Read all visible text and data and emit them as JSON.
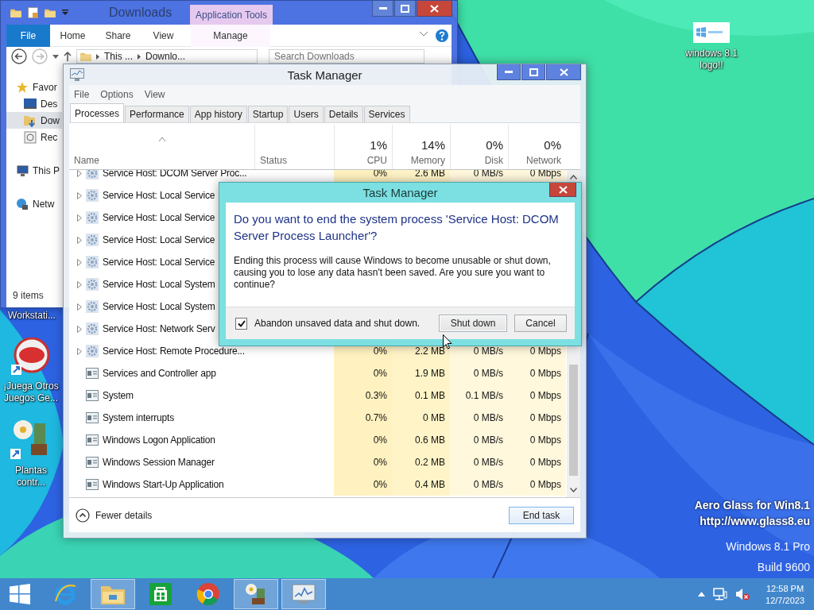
{
  "desktop": {
    "icons": [
      {
        "label": "Workstati...",
        "kind": "hidden"
      },
      {
        "label": "¡Juega Otros Juegos Ge...",
        "kind": "popcap"
      },
      {
        "label": "Plantas contr...",
        "kind": "plants"
      },
      {
        "label": "windows 8.1 logo!!"
      }
    ],
    "overlay_text": [
      "Aero Glass for Win8.1",
      "http://www.glass8.eu"
    ],
    "edition": [
      "Windows 8.1 Pro",
      "Build 9600"
    ]
  },
  "explorer": {
    "title": "Downloads",
    "context_tab": "Application Tools",
    "ribbon_tabs": [
      {
        "label": "File",
        "kind": "file"
      },
      {
        "label": "Home",
        "kind": "tab"
      },
      {
        "label": "Share",
        "kind": "tab"
      },
      {
        "label": "View",
        "kind": "tab"
      },
      {
        "label": "Manage",
        "kind": "context"
      }
    ],
    "address": [
      "This ...",
      "Downlo..."
    ],
    "search": {
      "placeholder": "Search Downloads"
    },
    "nav": [
      {
        "label": "Favor",
        "kind": "star",
        "selected": false
      },
      {
        "label": "Des",
        "kind": "desktop",
        "selected": false
      },
      {
        "label": "Dow",
        "kind": "downloads",
        "selected": true
      },
      {
        "label": "Rec",
        "kind": "recent",
        "selected": false
      },
      {
        "label": "This P",
        "kind": "computer",
        "selected": false
      },
      {
        "label": "Netw",
        "kind": "network",
        "selected": false
      }
    ],
    "status": "9 items"
  },
  "task_manager": {
    "title": "Task Manager",
    "menu": [
      "File",
      "Options",
      "View"
    ],
    "tabs": [
      {
        "label": "Processes",
        "selected": true
      },
      {
        "label": "Performance",
        "selected": false
      },
      {
        "label": "App history",
        "selected": false
      },
      {
        "label": "Startup",
        "selected": false
      },
      {
        "label": "Users",
        "selected": false
      },
      {
        "label": "Details",
        "selected": false
      },
      {
        "label": "Services",
        "selected": false
      }
    ],
    "columns": [
      {
        "label": "Name",
        "sorted": true
      },
      {
        "label": "Status",
        "sorted": false
      },
      {
        "label": "CPU",
        "total": "1%",
        "sorted": false
      },
      {
        "label": "Memory",
        "total": "14%",
        "sorted": false
      },
      {
        "label": "Disk",
        "total": "0%",
        "sorted": false
      },
      {
        "label": "Network",
        "total": "0%",
        "sorted": false
      }
    ],
    "rows": [
      {
        "name": "Service Host: DCOM Server Proc...",
        "kind": "service",
        "cells": [
          "0%",
          "2.6 MB",
          "0 MB/s",
          "0 Mbps"
        ]
      },
      {
        "name": "Service Host: Local Service",
        "kind": "service"
      },
      {
        "name": "Service Host: Local Service",
        "kind": "service"
      },
      {
        "name": "Service Host: Local Service",
        "kind": "service"
      },
      {
        "name": "Service Host: Local Service",
        "kind": "service"
      },
      {
        "name": "Service Host: Local System",
        "kind": "service"
      },
      {
        "name": "Service Host: Local System",
        "kind": "service"
      },
      {
        "name": "Service Host: Network Serv",
        "kind": "service"
      },
      {
        "name": "Service Host: Remote Procedure...",
        "kind": "service",
        "cells": [
          "0%",
          "2.2 MB",
          "0 MB/s",
          "0 Mbps"
        ]
      },
      {
        "name": "Services and Controller app",
        "kind": "app",
        "cells": [
          "0%",
          "1.9 MB",
          "0 MB/s",
          "0 Mbps"
        ]
      },
      {
        "name": "System",
        "kind": "app",
        "cells": [
          "0.3%",
          "0.1 MB",
          "0.1 MB/s",
          "0 Mbps"
        ]
      },
      {
        "name": "System interrupts",
        "kind": "app",
        "cells": [
          "0.7%",
          "0 MB",
          "0 MB/s",
          "0 Mbps"
        ]
      },
      {
        "name": "Windows Logon Application",
        "kind": "app",
        "cells": [
          "0%",
          "0.6 MB",
          "0 MB/s",
          "0 Mbps"
        ]
      },
      {
        "name": "Windows Session Manager",
        "kind": "app",
        "cells": [
          "0%",
          "0.2 MB",
          "0 MB/s",
          "0 Mbps"
        ]
      },
      {
        "name": "Windows Start-Up Application",
        "kind": "app",
        "cells": [
          "0%",
          "0.4 MB",
          "0 MB/s",
          "0 Mbps"
        ]
      }
    ],
    "fewer_details": "Fewer details",
    "end_task": "End task"
  },
  "dialog": {
    "title": "Task Manager",
    "heading": "Do you want to end the system process 'Service Host: DCOM Server Process Launcher'?",
    "body": "Ending this process will cause Windows to become unusable or shut down, causing you to lose any data hasn't been saved. Are you sure you want to continue?",
    "checkbox": {
      "label": "Abandon unsaved data and shut down.",
      "checked": true
    },
    "buttons": [
      {
        "label": "Shut down",
        "kind": "hover"
      },
      {
        "label": "Cancel",
        "kind": "normal"
      }
    ]
  },
  "taskbar": {
    "items": [
      {
        "kind": "ie",
        "active": false
      },
      {
        "kind": "explorer",
        "active": true
      },
      {
        "kind": "store",
        "active": false
      },
      {
        "kind": "chrome",
        "active": false
      },
      {
        "kind": "plants",
        "active": true
      },
      {
        "kind": "taskmgr",
        "active": true
      }
    ],
    "time": "12:58 PM",
    "date": "12/7/2023"
  }
}
